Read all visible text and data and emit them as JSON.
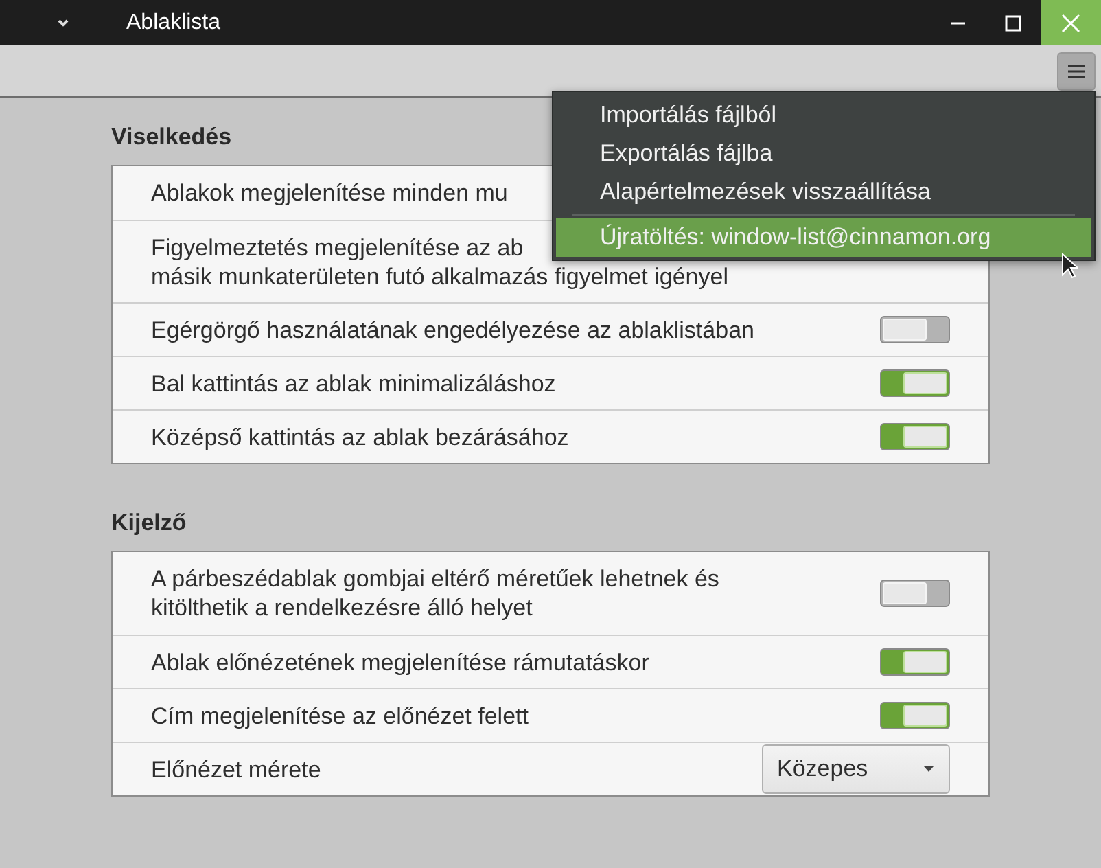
{
  "window": {
    "title": "Ablaklista"
  },
  "sections": [
    {
      "title": "Viselkedés",
      "rows": [
        {
          "kind": "label",
          "label": "Ablakok megjelenítése minden mu"
        },
        {
          "kind": "label",
          "label": "Figyelmeztetés megjelenítése az ab",
          "label2": "másik munkaterületen futó alkalmazás figyelmet igényel"
        },
        {
          "kind": "switch",
          "label": "Egérgörgő használatának engedélyezése az ablaklistában",
          "on": false
        },
        {
          "kind": "switch",
          "label": "Bal kattintás az ablak minimalizáláshoz",
          "on": true
        },
        {
          "kind": "switch",
          "label": "Középső kattintás az ablak bezárásához",
          "on": true
        }
      ]
    },
    {
      "title": "Kijelző",
      "rows": [
        {
          "kind": "switch",
          "label": "A párbeszédablak gombjai eltérő méretűek lehetnek és",
          "label2": "kitölthetik a rendelkezésre álló helyet",
          "on": false
        },
        {
          "kind": "switch",
          "label": "Ablak előnézetének megjelenítése rámutatáskor",
          "on": true
        },
        {
          "kind": "switch",
          "label": "Cím megjelenítése az előnézet felett",
          "on": true
        },
        {
          "kind": "combo",
          "label": "Előnézet mérete",
          "value": "Közepes"
        }
      ]
    }
  ],
  "menu": {
    "items": [
      {
        "label": "Importálás fájlból",
        "selected": false
      },
      {
        "label": "Exportálás fájlba",
        "selected": false
      },
      {
        "label": "Alapértelmezések visszaállítása",
        "selected": false
      },
      {
        "label": "Újratöltés: window-list@cinnamon.org",
        "selected": true,
        "separator_before": true
      }
    ]
  }
}
